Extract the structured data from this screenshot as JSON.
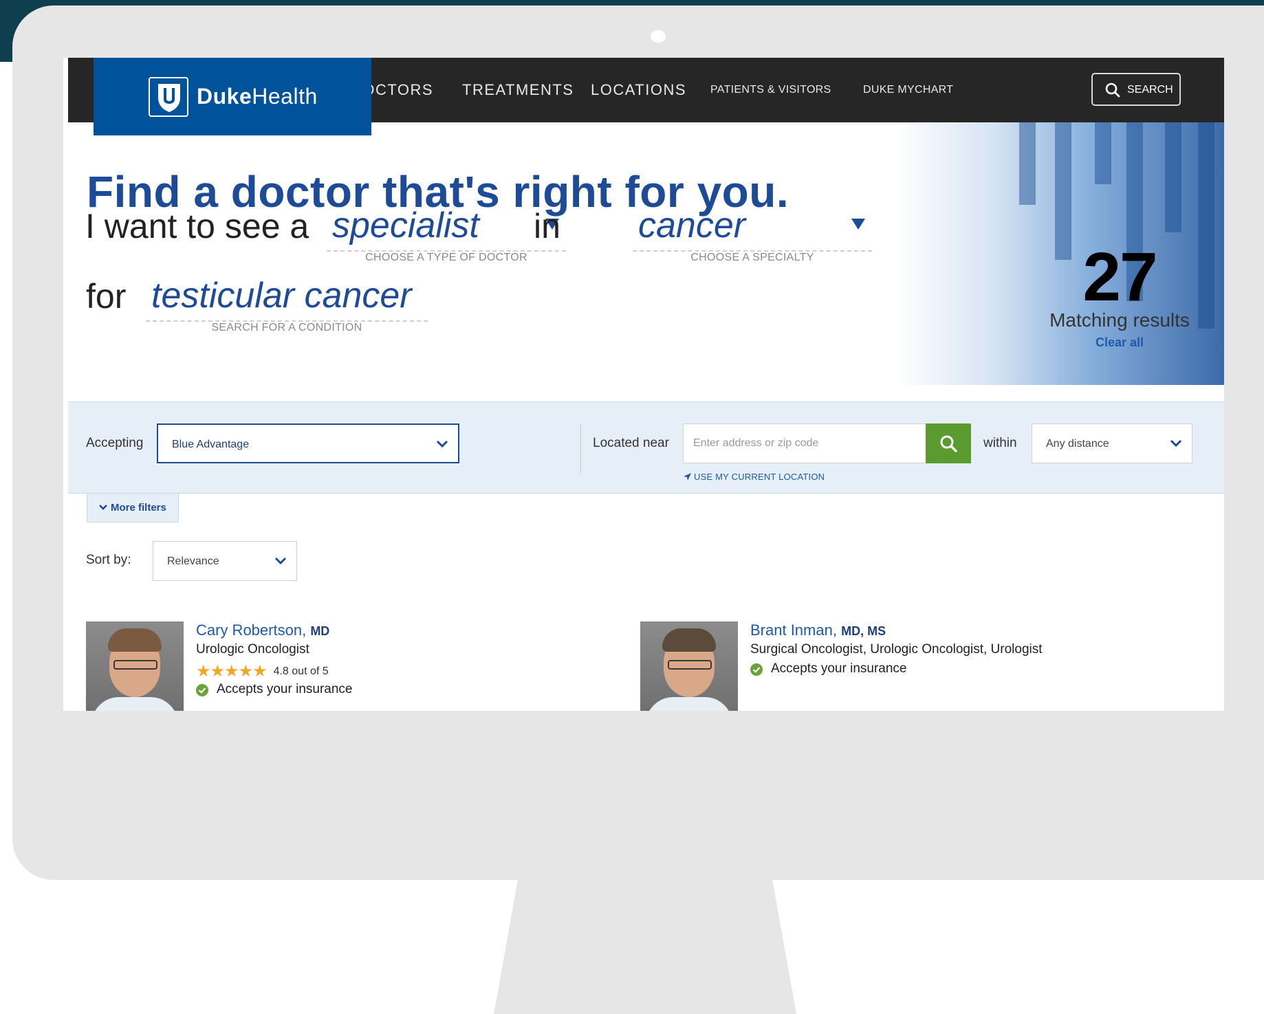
{
  "nav": {
    "logo": {
      "bold": "Duke",
      "regular": "Health"
    },
    "items": [
      "DOCTORS",
      "TREATMENTS",
      "LOCATIONS",
      "PATIENTS & VISITORS",
      "DUKE MYCHART"
    ],
    "search_label": "SEARCH"
  },
  "hero": {
    "title": "Find a doctor that's right for you.",
    "prefix": "I want to see a",
    "doctor_type": "specialist",
    "doctor_type_caption": "CHOOSE A TYPE OF DOCTOR",
    "in_word": "in",
    "specialty": "cancer",
    "specialty_caption": "CHOOSE A SPECIALTY",
    "for_word": "for",
    "condition": "testicular cancer",
    "condition_caption": "SEARCH FOR A CONDITION",
    "result_count": "27",
    "result_label": "Matching results",
    "clear_all": "Clear all"
  },
  "filters": {
    "accepting_label": "Accepting",
    "insurance_value": "Blue Advantage",
    "located_label": "Located near",
    "address_placeholder": "Enter address or zip code",
    "within_label": "within",
    "distance_value": "Any distance",
    "use_location": "USE MY CURRENT LOCATION",
    "more_filters": "More filters"
  },
  "sort": {
    "label": "Sort by:",
    "value": "Relevance"
  },
  "results": [
    {
      "name": "Cary Robertson",
      "credentials": "MD",
      "specialty": "Urologic Oncologist",
      "rating_text": "4.8 out of 5",
      "rating": 4.8,
      "insurance": "Accepts your insurance"
    },
    {
      "name": "Brant Inman",
      "credentials": "MD, MS",
      "specialty": "Surgical Oncologist, Urologic Oncologist, Urologist",
      "insurance": "Accepts your insurance"
    }
  ],
  "colors": {
    "brand_blue": "#00539b",
    "heading_blue": "#1e4b97",
    "link_blue": "#1e5aa8",
    "nav_bg": "#262626",
    "search_green": "#5a9a2e",
    "check_green": "#6aa33a",
    "star_gold": "#f5a623",
    "filter_bg": "#e6eef7"
  }
}
